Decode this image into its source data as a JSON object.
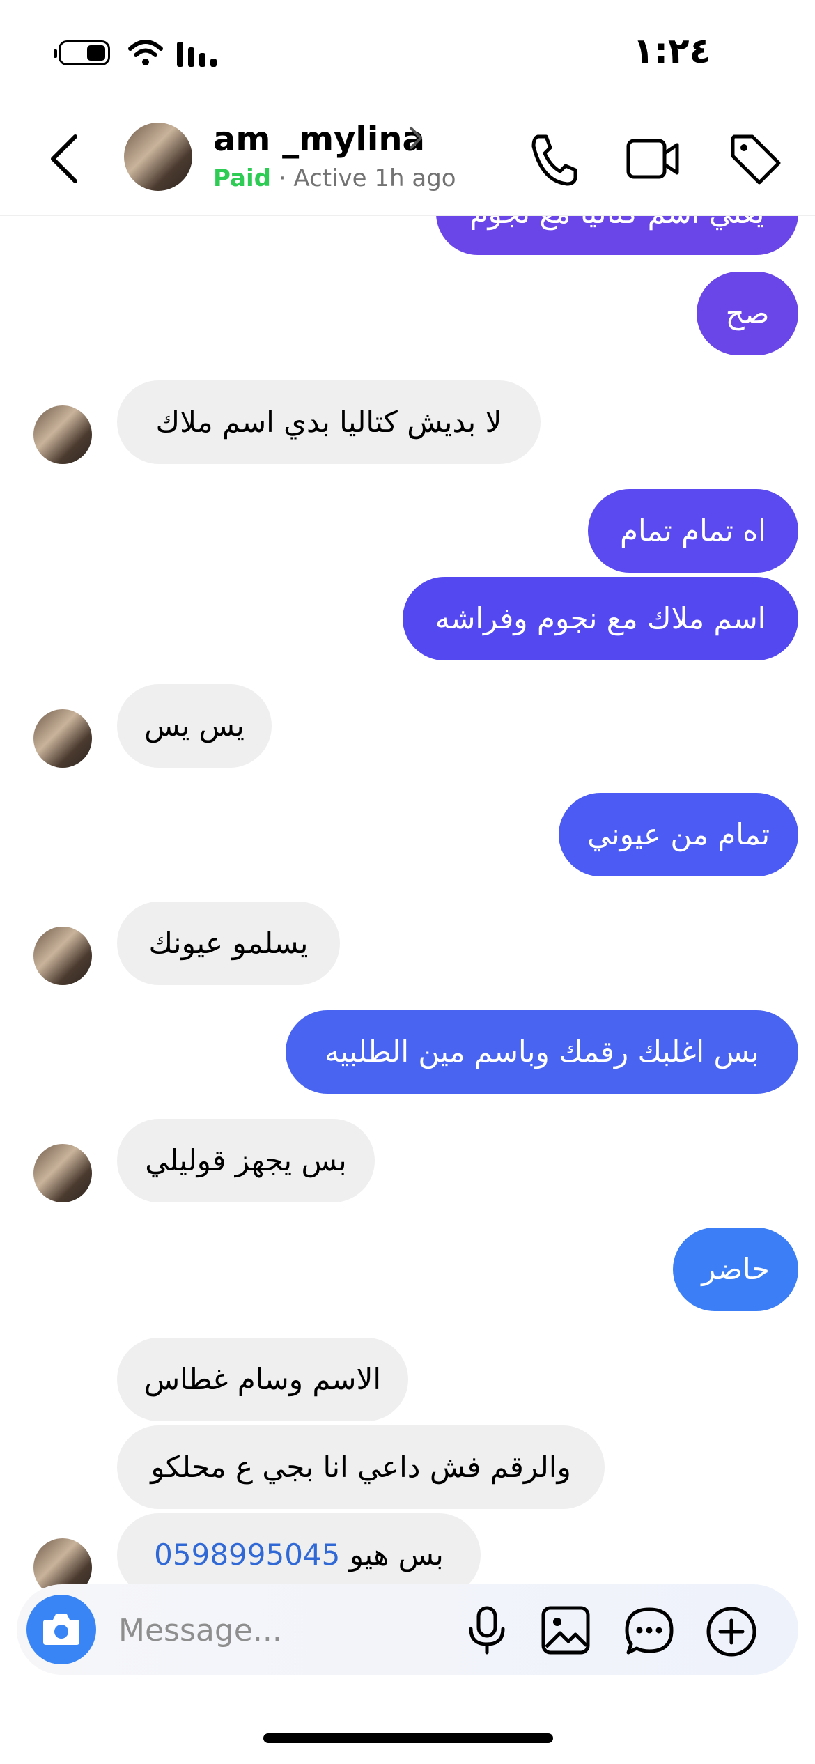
{
  "status": {
    "time": "١:٢٤"
  },
  "header": {
    "username": "am _mylina",
    "paid_label": "Paid",
    "separator": "·",
    "active_label": "Active 1h ago"
  },
  "messages": [
    {
      "side": "out",
      "text": "يعني اسم كتاليا مع نجوم",
      "color": "#6a45e8"
    },
    {
      "side": "out",
      "text": "صح",
      "color": "#6a45e8"
    },
    {
      "side": "in",
      "text": "لا بديش كتاليا بدي اسم ملاك"
    },
    {
      "side": "out",
      "text": "اه تمام تمام",
      "color": "#5a4af0"
    },
    {
      "side": "out",
      "text": "اسم ملاك مع نجوم وفراشه",
      "color": "#5448f0"
    },
    {
      "side": "in",
      "text": "يس يس"
    },
    {
      "side": "out",
      "text": "تمام من عيوني",
      "color": "#4b5bf3"
    },
    {
      "side": "in",
      "text": "يسلمو عيونك"
    },
    {
      "side": "out",
      "text": "بس اغلبك رقمك وباسم مين الطلبيه",
      "color": "#4a64f2"
    },
    {
      "side": "in",
      "text": "بس يجهز قوليلي"
    },
    {
      "side": "out",
      "text": "حاضر",
      "color": "#3b7ef6"
    },
    {
      "side": "in",
      "text": "الاسم وسام غطاس"
    },
    {
      "side": "in",
      "text": "والرقم فش داعي انا بجي ع محلكو"
    },
    {
      "side": "in",
      "text": "بس هيو",
      "phone": "0598995045"
    }
  ],
  "composer": {
    "placeholder": "Message..."
  },
  "colors": {
    "paid": "#2ecc55",
    "camera_button": "#3a85f5",
    "link": "#3069d6",
    "incoming_bubble": "#efefef"
  }
}
